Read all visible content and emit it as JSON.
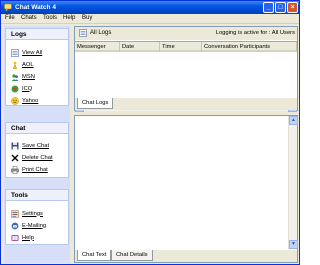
{
  "window": {
    "title": "Chat Watch 4"
  },
  "menu": [
    "File",
    "Chats",
    "Tools",
    "Help",
    "Buy"
  ],
  "sidebar": {
    "logs": {
      "title": "Logs",
      "items": [
        {
          "label": "View All",
          "icon": "view-all-icon"
        },
        {
          "label": "AOL",
          "icon": "aol-icon"
        },
        {
          "label": "MSN",
          "icon": "msn-icon"
        },
        {
          "label": "ICQ",
          "icon": "icq-icon"
        },
        {
          "label": "Yahoo",
          "icon": "yahoo-icon"
        }
      ]
    },
    "chat": {
      "title": "Chat",
      "items": [
        {
          "label": "Save Chat",
          "icon": "save-icon"
        },
        {
          "label": "Delete Chat",
          "icon": "delete-icon"
        },
        {
          "label": "Print Chat",
          "icon": "print-icon"
        }
      ]
    },
    "tools": {
      "title": "Tools",
      "items": [
        {
          "label": "Settings",
          "icon": "settings-icon"
        },
        {
          "label": "E-Mailing",
          "icon": "email-icon"
        },
        {
          "label": "Help",
          "icon": "help-icon"
        }
      ]
    }
  },
  "logs_panel": {
    "header": "All Logs",
    "status": "Logging is active for : All Users",
    "columns": [
      "Messenger",
      "Date",
      "Time",
      "Conversation Participants"
    ],
    "tabs": [
      "Chat Logs"
    ]
  },
  "chat_panel": {
    "tabs": [
      "Chat Text",
      "Chat Details"
    ]
  },
  "colors": {
    "titlebar": "#0054e3",
    "panel": "#d6dff7",
    "window_bg": "#ece9d8"
  }
}
